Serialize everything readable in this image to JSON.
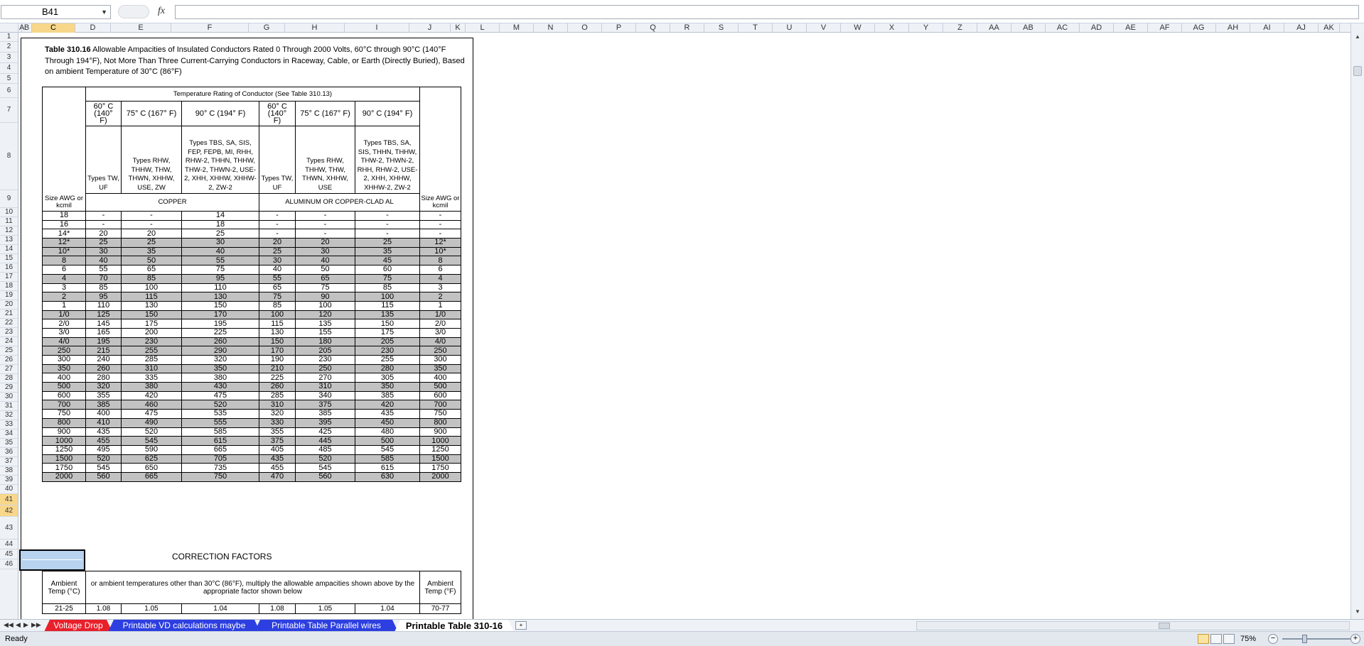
{
  "formula_bar": {
    "name_box": "B41",
    "fx_label": "fx",
    "formula": ""
  },
  "columns": [
    {
      "label": "A",
      "w": 4
    },
    {
      "label": "B",
      "w": 14
    },
    {
      "label": "C",
      "w": 61
    },
    {
      "label": "D",
      "w": 50
    },
    {
      "label": "E",
      "w": 85
    },
    {
      "label": "F",
      "w": 109
    },
    {
      "label": "G",
      "w": 51
    },
    {
      "label": "H",
      "w": 84
    },
    {
      "label": "I",
      "w": 91
    },
    {
      "label": "J",
      "w": 58
    },
    {
      "label": "K",
      "w": 21
    },
    {
      "label": "L",
      "w": 48
    },
    {
      "label": "M",
      "w": 48
    },
    {
      "label": "N",
      "w": 48
    },
    {
      "label": "O",
      "w": 48
    },
    {
      "label": "P",
      "w": 48
    },
    {
      "label": "Q",
      "w": 48
    },
    {
      "label": "R",
      "w": 48
    },
    {
      "label": "S",
      "w": 48
    },
    {
      "label": "T",
      "w": 48
    },
    {
      "label": "U",
      "w": 48
    },
    {
      "label": "V",
      "w": 48
    },
    {
      "label": "W",
      "w": 48
    },
    {
      "label": "X",
      "w": 48
    },
    {
      "label": "Y",
      "w": 48
    },
    {
      "label": "Z",
      "w": 48
    },
    {
      "label": "AA",
      "w": 48
    },
    {
      "label": "AB",
      "w": 48
    },
    {
      "label": "AC",
      "w": 48
    },
    {
      "label": "AD",
      "w": 48
    },
    {
      "label": "AE",
      "w": 48
    },
    {
      "label": "AF",
      "w": 48
    },
    {
      "label": "AG",
      "w": 48
    },
    {
      "label": "AH",
      "w": 48
    },
    {
      "label": "AI",
      "w": 48
    },
    {
      "label": "AJ",
      "w": 48
    },
    {
      "label": "AK",
      "w": 30
    }
  ],
  "rows": [
    {
      "n": "1",
      "h": 13
    },
    {
      "n": "2",
      "h": 15
    },
    {
      "n": "3",
      "h": 15
    },
    {
      "n": "4",
      "h": 15
    },
    {
      "n": "5",
      "h": 14
    },
    {
      "n": "6",
      "h": 20
    },
    {
      "n": "7",
      "h": 35
    },
    {
      "n": "8",
      "h": 95
    },
    {
      "n": "9",
      "h": 25
    },
    {
      "n": "10",
      "h": 13
    },
    {
      "n": "11",
      "h": 13
    },
    {
      "n": "12",
      "h": 13
    },
    {
      "n": "13",
      "h": 13
    },
    {
      "n": "14",
      "h": 13
    },
    {
      "n": "15",
      "h": 13
    },
    {
      "n": "16",
      "h": 13
    },
    {
      "n": "17",
      "h": 13
    },
    {
      "n": "18",
      "h": 13
    },
    {
      "n": "19",
      "h": 13
    },
    {
      "n": "20",
      "h": 13
    },
    {
      "n": "21",
      "h": 13
    },
    {
      "n": "22",
      "h": 13
    },
    {
      "n": "23",
      "h": 13
    },
    {
      "n": "24",
      "h": 13
    },
    {
      "n": "25",
      "h": 13
    },
    {
      "n": "26",
      "h": 13
    },
    {
      "n": "27",
      "h": 13
    },
    {
      "n": "28",
      "h": 13
    },
    {
      "n": "29",
      "h": 13
    },
    {
      "n": "30",
      "h": 13
    },
    {
      "n": "31",
      "h": 13
    },
    {
      "n": "32",
      "h": 13
    },
    {
      "n": "33",
      "h": 13
    },
    {
      "n": "34",
      "h": 13
    },
    {
      "n": "35",
      "h": 13
    },
    {
      "n": "36",
      "h": 13
    },
    {
      "n": "37",
      "h": 13
    },
    {
      "n": "38",
      "h": 13
    },
    {
      "n": "39",
      "h": 13
    },
    {
      "n": "40",
      "h": 13
    },
    {
      "n": "41",
      "h": 16
    },
    {
      "n": "42",
      "h": 16
    },
    {
      "n": "43",
      "h": 32
    },
    {
      "n": "44",
      "h": 14
    },
    {
      "n": "45",
      "h": 14
    },
    {
      "n": "46",
      "h": 14
    }
  ],
  "selected_col": "C",
  "selected_rows": [
    "41",
    "42"
  ],
  "title": {
    "bold": "Table 310.16",
    "text": " Allowable Ampacities of Insulated Conductors Rated 0 Through 2000 Volts, 60°C through 90°C (140°F Through 194°F), Not More Than Three Current-Carrying Conductors in Raceway, Cable, or Earth (Directly Buried), Based on ambient Temperature of 30°C (86°F)"
  },
  "header": {
    "temp_rating": "Temperature Rating of Conductor (See Table 310.13)",
    "temps": [
      "60° C (140° F)",
      "75° C (167° F)",
      "90° C (194° F)",
      "60° C (140° F)",
      "75° C (167° F)",
      "90° C (194° F)"
    ],
    "types": [
      "Types TW, UF",
      "Types RHW, THHW, THW, THWN, XHHW, USE, ZW",
      "Types TBS, SA, SIS, FEP, FEPB, MI, RHH, RHW-2, THHN, THHW, THW-2, THWN-2, USE-2, XHH, XHHW, XHHW-2, ZW-2",
      "Types TW, UF",
      "Types RHW, THHW, THW, THWN, XHHW, USE",
      "Types TBS, SA, SIS, THHN, THHW, THW-2, THWN-2, RHH, RHW-2, USE-2, XHH, XHHW, XHHW-2, ZW-2"
    ],
    "size_left": "Size AWG or kcmil",
    "copper": "COPPER",
    "aluminum": "ALUMINUM OR COPPER-CLAD AL",
    "size_right": "Size AWG or kcmil"
  },
  "table_rows": [
    [
      "18",
      "-",
      "-",
      "14",
      "-",
      "-",
      "-",
      "-"
    ],
    [
      "16",
      "-",
      "-",
      "18",
      "-",
      "-",
      "-",
      "-"
    ],
    [
      "14*",
      "20",
      "20",
      "25",
      "-",
      "-",
      "-",
      "-"
    ],
    [
      "12*",
      "25",
      "25",
      "30",
      "20",
      "20",
      "25",
      "12*"
    ],
    [
      "10*",
      "30",
      "35",
      "40",
      "25",
      "30",
      "35",
      "10*"
    ],
    [
      "8",
      "40",
      "50",
      "55",
      "30",
      "40",
      "45",
      "8"
    ],
    [
      "6",
      "55",
      "65",
      "75",
      "40",
      "50",
      "60",
      "6"
    ],
    [
      "4",
      "70",
      "85",
      "95",
      "55",
      "65",
      "75",
      "4"
    ],
    [
      "3",
      "85",
      "100",
      "110",
      "65",
      "75",
      "85",
      "3"
    ],
    [
      "2",
      "95",
      "115",
      "130",
      "75",
      "90",
      "100",
      "2"
    ],
    [
      "1",
      "110",
      "130",
      "150",
      "85",
      "100",
      "115",
      "1"
    ],
    [
      "1/0",
      "125",
      "150",
      "170",
      "100",
      "120",
      "135",
      "1/0"
    ],
    [
      "2/0",
      "145",
      "175",
      "195",
      "115",
      "135",
      "150",
      "2/0"
    ],
    [
      "3/0",
      "165",
      "200",
      "225",
      "130",
      "155",
      "175",
      "3/0"
    ],
    [
      "4/0",
      "195",
      "230",
      "260",
      "150",
      "180",
      "205",
      "4/0"
    ],
    [
      "250",
      "215",
      "255",
      "290",
      "170",
      "205",
      "230",
      "250"
    ],
    [
      "300",
      "240",
      "285",
      "320",
      "190",
      "230",
      "255",
      "300"
    ],
    [
      "350",
      "260",
      "310",
      "350",
      "210",
      "250",
      "280",
      "350"
    ],
    [
      "400",
      "280",
      "335",
      "380",
      "225",
      "270",
      "305",
      "400"
    ],
    [
      "500",
      "320",
      "380",
      "430",
      "260",
      "310",
      "350",
      "500"
    ],
    [
      "600",
      "355",
      "420",
      "475",
      "285",
      "340",
      "385",
      "600"
    ],
    [
      "700",
      "385",
      "460",
      "520",
      "310",
      "375",
      "420",
      "700"
    ],
    [
      "750",
      "400",
      "475",
      "535",
      "320",
      "385",
      "435",
      "750"
    ],
    [
      "800",
      "410",
      "490",
      "555",
      "330",
      "395",
      "450",
      "800"
    ],
    [
      "900",
      "435",
      "520",
      "585",
      "355",
      "425",
      "480",
      "900"
    ],
    [
      "1000",
      "455",
      "545",
      "615",
      "375",
      "445",
      "500",
      "1000"
    ],
    [
      "1250",
      "495",
      "590",
      "665",
      "405",
      "485",
      "545",
      "1250"
    ],
    [
      "1500",
      "520",
      "625",
      "705",
      "435",
      "520",
      "585",
      "1500"
    ],
    [
      "1750",
      "545",
      "650",
      "735",
      "455",
      "545",
      "615",
      "1750"
    ],
    [
      "2000",
      "560",
      "665",
      "750",
      "470",
      "560",
      "630",
      "2000"
    ]
  ],
  "gray_rows": [
    3,
    4,
    5,
    7,
    9,
    11,
    14,
    15,
    17,
    19,
    21,
    23,
    25,
    27,
    29
  ],
  "correction": {
    "title": "CORRECTION FACTORS",
    "ambient_c": "Ambient Temp (°C)",
    "note": "or ambient temperatures other than 30°C (86°F), multiply the allowable ampacities shown above by the appropriate factor shown below",
    "ambient_f": "Ambient Temp (°F)",
    "row": [
      "21-25",
      "1.08",
      "1.05",
      "1.04",
      "1.08",
      "1.05",
      "1.04",
      "70-77"
    ]
  },
  "tabs": [
    {
      "label": "Voltage Drop",
      "color": "#e8202a"
    },
    {
      "label": "Printable VD calculations maybe",
      "color": "#2d3fe0"
    },
    {
      "label": "Printable Table Parallel wires",
      "color": "#2d3fe0"
    },
    {
      "label": "Printable Table 310-16",
      "color": "#ffffff"
    }
  ],
  "status": {
    "ready": "Ready",
    "zoom": "75%"
  }
}
